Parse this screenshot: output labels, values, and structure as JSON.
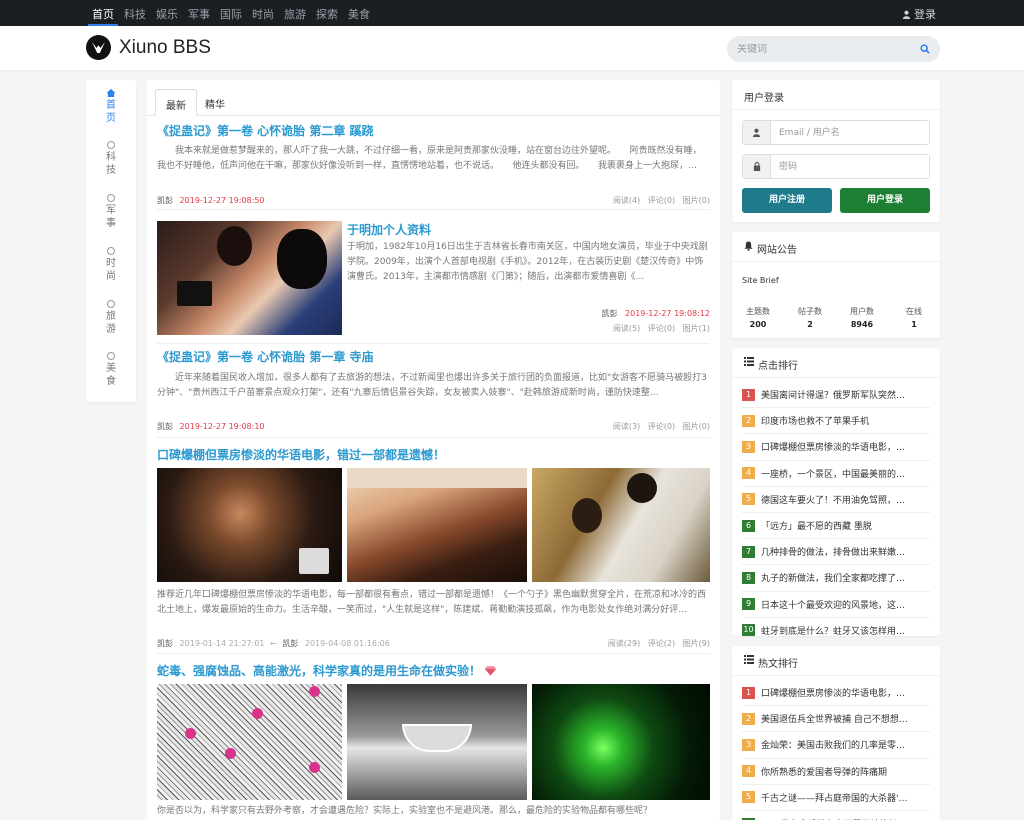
{
  "topnav": {
    "items": [
      "首页",
      "科技",
      "娱乐",
      "军事",
      "国际",
      "时尚",
      "旅游",
      "探索",
      "美食"
    ],
    "login": "登录"
  },
  "header": {
    "logo_text": "Xiuno BBS",
    "search_placeholder": "关键词"
  },
  "leftnav": {
    "items": [
      {
        "label": "首页",
        "active": true
      },
      {
        "label": "科技"
      },
      {
        "label": "军事"
      },
      {
        "label": "时尚"
      },
      {
        "label": "旅游"
      },
      {
        "label": "美食"
      }
    ]
  },
  "tabs": [
    "最新",
    "精华"
  ],
  "posts": [
    {
      "title": "《捉蛊记》第一卷 心怀诡胎 第二章 蹊跷",
      "excerpt": "我本来就是做惹梦醒来的，那人吓了我一大跳，不过仔细一看，原来是阿贵那家伙没睡，站在窗台边往外望呢。　　阿贵既然没有睡，我也不好睡他，低声问他在干嘛，那家伙好像没听到一样，直愣愣地站着，也不说话。　　他连头都没有回。　　我裹裹身上一大抱尿，…",
      "author": "凯彭",
      "date": "2019-12-27 19:08:50",
      "stats": [
        "阅读(4)",
        "评论(0)",
        "图片(0)"
      ]
    },
    {
      "title": "于明加个人资料",
      "excerpt": "于明加，1982年10月16日出生于吉林省长春市南关区，中国内地女演员，毕业于中央戏剧学院。2009年，出演个人首部电视剧《手机》。2012年，在古装历史剧《楚汉传奇》中饰演曹氏。2013年，主演都市情感剧《门第》；随后，出演都市爱情喜剧《…",
      "author": "凯彭",
      "date": "2019-12-27 19:08:12",
      "stats": [
        "阅读(5)",
        "评论(0)",
        "图片(1)"
      ]
    },
    {
      "title": "《捉蛊记》第一卷 心怀诡胎 第一章 寺庙",
      "excerpt": "近年来随着国民收入增加，很多人都有了去旅游的想法，不过新闻里也爆出许多关于旅行团的负面报道，比如\"女游客不愿骑马被殴打3分钟\"、\"贵州西江千户苗寨景点观众打架\"，还有\"九寨后情侣景谷失踪，女友被卖入妓寨\"、\"赴韩旅游成新时尚，谨防快速整…",
      "author": "凯彭",
      "date": "2019-12-27 19:08:10",
      "stats": [
        "阅读(3)",
        "评论(0)",
        "图片(0)"
      ]
    },
    {
      "title": "口碑爆棚但票房惨淡的华语电影，错过一部都是遗憾！",
      "excerpt": "推荐近几年口碑爆棚但票房惨淡的华语电影，每一部都很有看点，错过一部都是遗憾！《一个勺子》黑色幽默贯穿全片，在荒凉和冰冷的西北土地上，爆发最原始的生命力。生活辛酸，一笑而过，\"人生就是这样\"，陈建斌、蒋勤勤演技孤飙，作为电影处女作绝对满分好评…",
      "author": "凯彭",
      "date": "2019-01-14 21:27:01",
      "last_author": "凯彭",
      "last_date": "2019-04-08 01:16:06",
      "stats": [
        "阅读(29)",
        "评论(2)",
        "图片(9)"
      ]
    },
    {
      "title": "蛇毒、强腐蚀品、高能激光，科学家真的是用生命在做实验！",
      "excerpt": "你是否以为，科学家只有去野外考察，才会遭遇危险？实际上，实验室也不是避风港。那么，最危险的实验物品都有哪些呢？"
    }
  ],
  "login_panel": {
    "title": "用户登录",
    "email_placeholder": "Email / 用户名",
    "password_placeholder": "密码",
    "register": "用户注册",
    "login": "用户登录"
  },
  "notice_panel": {
    "title": "网站公告",
    "brief": "Site Brief",
    "stats": [
      {
        "label": "主题数",
        "value": "200"
      },
      {
        "label": "帖子数",
        "value": "2"
      },
      {
        "label": "用户数",
        "value": "8946"
      },
      {
        "label": "在线",
        "value": "1"
      }
    ]
  },
  "click_rank": {
    "title": "点击排行",
    "items": [
      {
        "num": "1",
        "text": "美国离间计得逞？俄罗斯军队突然…",
        "color": "#d9534f"
      },
      {
        "num": "2",
        "text": "印度市场也救不了苹果手机",
        "color": "#f0ad4e"
      },
      {
        "num": "3",
        "text": "口碑爆棚但票房惨淡的华语电影，…",
        "color": "#f0ad4e"
      },
      {
        "num": "4",
        "text": "一座桥，一个景区，中国最美丽的…",
        "color": "#f0ad4e"
      },
      {
        "num": "5",
        "text": "德国这车要火了！不用油免驾照，…",
        "color": "#f0ad4e"
      },
      {
        "num": "6",
        "text": "「远方」最不愿的西藏 墨脱",
        "color": "#2e7d32"
      },
      {
        "num": "7",
        "text": "几种排骨的做法，排骨做出来鲜嫩…",
        "color": "#2e7d32"
      },
      {
        "num": "8",
        "text": "丸子的新做法，我们全家都吃撑了…",
        "color": "#2e7d32"
      },
      {
        "num": "9",
        "text": "日本这十个最受欢迎的风景地，这…",
        "color": "#2e7d32"
      },
      {
        "num": "10",
        "text": "蛀牙到底是什么？蛀牙又该怎样用…",
        "color": "#2e7d32"
      }
    ]
  },
  "hot_rank": {
    "title": "热文排行",
    "items": [
      {
        "num": "1",
        "text": "口碑爆棚但票房惨淡的华语电影，…",
        "color": "#d9534f"
      },
      {
        "num": "2",
        "text": "美国退伍兵全世界被捕 自己不想想…",
        "color": "#f0ad4e"
      },
      {
        "num": "3",
        "text": "金灿荣：美国击败我们的几率是零…",
        "color": "#f0ad4e"
      },
      {
        "num": "4",
        "text": "你所熟悉的爱国者导弹的阵痛期",
        "color": "#f0ad4e"
      },
      {
        "num": "5",
        "text": "千古之谜——拜占庭帝国的大杀器'…",
        "color": "#f0ad4e"
      },
      {
        "num": "6",
        "text": "IBM 发布全球首台商用量子计算机！",
        "color": "#2e7d32"
      }
    ]
  }
}
